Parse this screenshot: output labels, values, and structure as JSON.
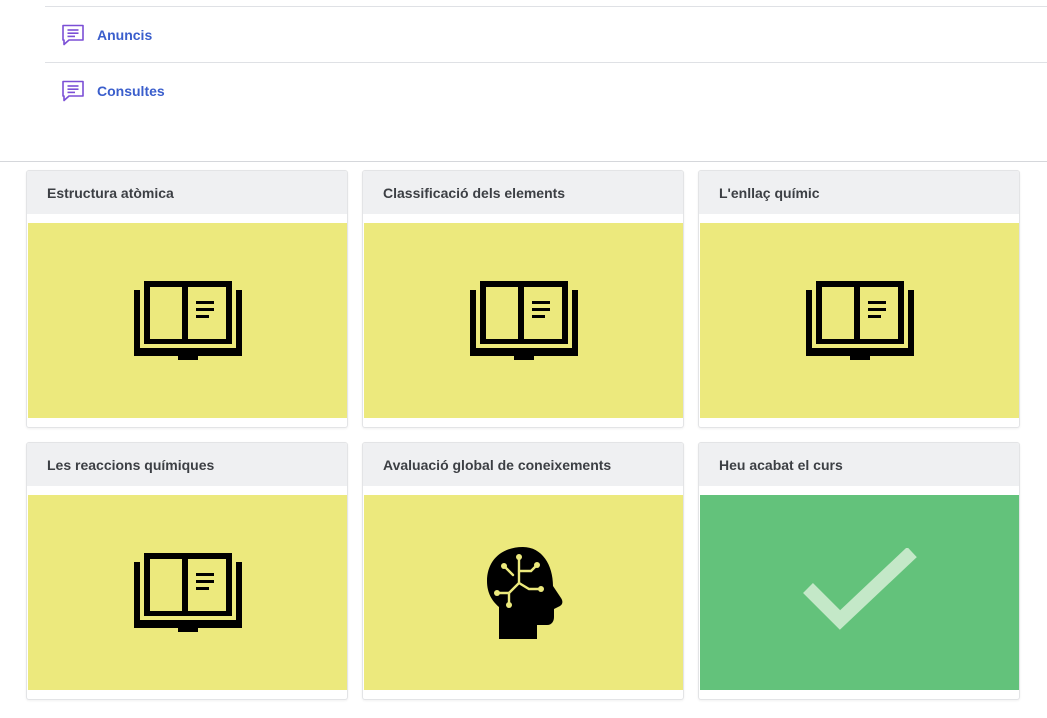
{
  "forums": [
    {
      "label": "Anuncis",
      "icon": "forum-chat-icon"
    },
    {
      "label": "Consultes",
      "icon": "forum-chat-icon"
    }
  ],
  "colors": {
    "link": "#3a5ecc",
    "icon_purple": "#7b4fd6",
    "tile_yellow": "#ece97d",
    "tile_green": "#63c27b"
  },
  "cards": [
    {
      "title": "Estructura atòmica",
      "icon": "open-book-icon"
    },
    {
      "title": "Classificació dels elements",
      "icon": "open-book-icon"
    },
    {
      "title": "L'enllaç químic",
      "icon": "open-book-icon"
    },
    {
      "title": "Les reaccions químiques",
      "icon": "open-book-icon"
    },
    {
      "title": "Avaluació global de coneixements",
      "icon": "brain-circuit-head-icon"
    },
    {
      "title": "Heu acabat el curs",
      "icon": "checkmark-icon"
    }
  ]
}
